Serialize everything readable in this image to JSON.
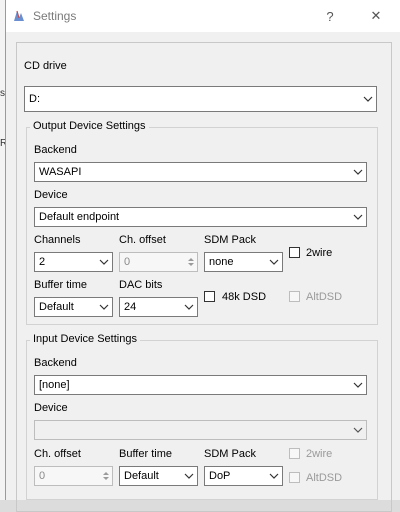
{
  "dialog": {
    "title": "Settings",
    "help_glyph": "?",
    "close_glyph": "✕"
  },
  "background": {
    "left_marks": [
      "s",
      "R"
    ]
  },
  "cd_drive": {
    "label": "CD drive",
    "value": "D:"
  },
  "output": {
    "group_title": "Output Device Settings",
    "backend_label": "Backend",
    "backend_value": "WASAPI",
    "device_label": "Device",
    "device_value": "Default endpoint",
    "channels_label": "Channels",
    "channels_value": "2",
    "ch_offset_label": "Ch. offset",
    "ch_offset_value": "0",
    "sdm_pack_label": "SDM Pack",
    "sdm_pack_value": "none",
    "twowire_label": "2wire",
    "buffer_time_label": "Buffer time",
    "buffer_time_value": "Default",
    "dac_bits_label": "DAC bits",
    "dac_bits_value": "24",
    "dsd48k_label": "48k DSD",
    "altdsd_label": "AltDSD"
  },
  "input": {
    "group_title": "Input Device Settings",
    "backend_label": "Backend",
    "backend_value": "[none]",
    "device_label": "Device",
    "device_value": "",
    "ch_offset_label": "Ch. offset",
    "ch_offset_value": "0",
    "buffer_time_label": "Buffer time",
    "buffer_time_value": "Default",
    "sdm_pack_label": "SDM Pack",
    "sdm_pack_value": "DoP",
    "twowire_label": "2wire",
    "altdsd_label": "AltDSD"
  }
}
